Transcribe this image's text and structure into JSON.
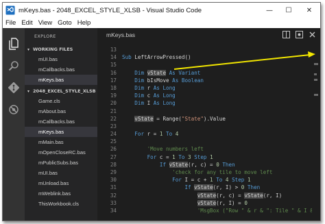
{
  "window": {
    "title": "mKeys.bas - 2048_EXCEL_STYLE_XLSB - Visual Studio Code",
    "min_glyph": "—",
    "max_glyph": "☐",
    "close_glyph": "✕"
  },
  "menu": [
    "File",
    "Edit",
    "View",
    "Goto",
    "Help"
  ],
  "activity_icons": [
    "files-icon",
    "search-icon",
    "git-icon",
    "debug-icon"
  ],
  "sidebar": {
    "header": "EXPLORE",
    "working_files_label": "WORKING FILES",
    "working_files": [
      "mUI.bas",
      "mCallbacks.bas",
      "mKeys.bas"
    ],
    "project_label": "2048_EXCEL_STYLE_XLSB",
    "project_files": [
      "Game.cls",
      "mAbout.bas",
      "mCallbacks.bas",
      "mKeys.bas",
      "mMain.bas",
      "mOpenCloseRC.bas",
      "mPublicSubs.bas",
      "mUI.bas",
      "mUnload.bas",
      "mWeblink.bas",
      "ThisWorkbook.cls"
    ],
    "selected_working": "mKeys.bas",
    "selected_project": "mKeys.bas"
  },
  "editor": {
    "tab": "mKeys.bas",
    "lines": [
      {
        "n": "13",
        "text": ""
      },
      {
        "n": "14",
        "text": "Sub LeftArrowPressed()"
      },
      {
        "n": "15",
        "text": ""
      },
      {
        "n": "16",
        "text": "    Dim vState As Variant"
      },
      {
        "n": "17",
        "text": "    Dim bIsMove As Boolean"
      },
      {
        "n": "18",
        "text": "    Dim r As Long"
      },
      {
        "n": "19",
        "text": "    Dim c As Long"
      },
      {
        "n": "20",
        "text": "    Dim I As Long"
      },
      {
        "n": "21",
        "text": ""
      },
      {
        "n": "22",
        "text": "    vState = Range(\"State\").Value"
      },
      {
        "n": "23",
        "text": ""
      },
      {
        "n": "24",
        "text": "    For r = 1 To 4"
      },
      {
        "n": "25",
        "text": ""
      },
      {
        "n": "26",
        "text": "        'Move numbers left"
      },
      {
        "n": "27",
        "text": "        For c = 1 To 3 Step 1"
      },
      {
        "n": "28",
        "text": "            If vState(r, c) = 0 Then"
      },
      {
        "n": "29",
        "text": "                'check for any tile to move left"
      },
      {
        "n": "30",
        "text": "                For I = c + 1 To 4 Step 1"
      },
      {
        "n": "31",
        "text": "                    If vState(r, I) > 0 Then"
      },
      {
        "n": "32",
        "text": "                        vState(r, c) = vState(r, I)"
      },
      {
        "n": "33",
        "text": "                        vState(r, I) = 0"
      },
      {
        "n": "34",
        "text": "                        'MsgBox (\"Row \" & r & \": Tile \" & I & \""
      }
    ]
  },
  "colors": {
    "keyword": "#569cd6",
    "string": "#ce9178",
    "number": "#b5cea8",
    "comment": "#608b4e",
    "annotation_arrow": "#f2e600"
  }
}
